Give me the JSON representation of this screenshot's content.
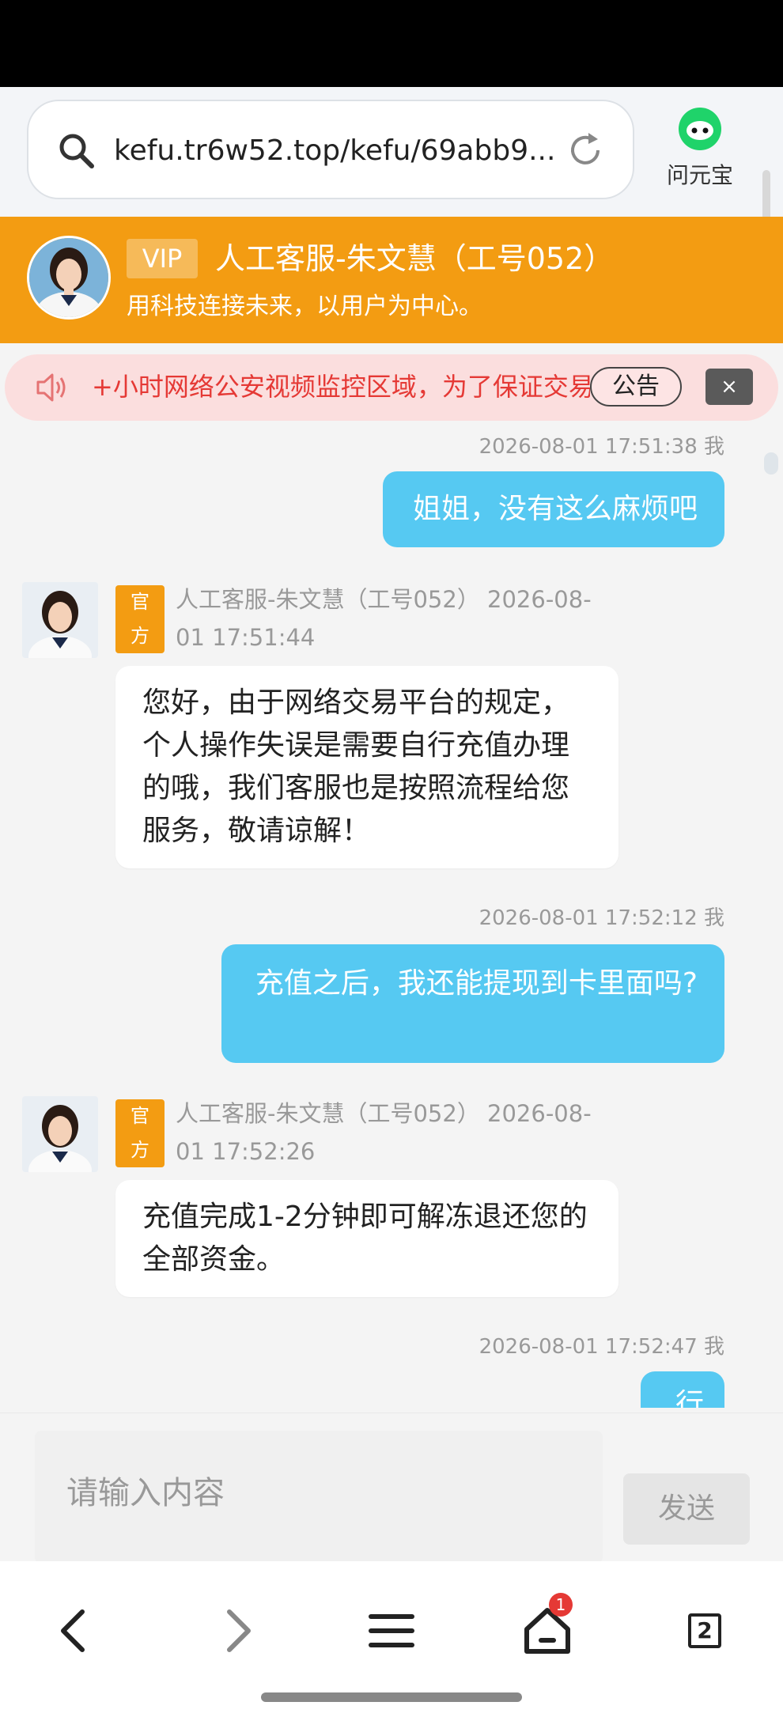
{
  "browser": {
    "url": "kefu.tr6w52.top/kefu/69abb9...",
    "assistant_label": "问元宝"
  },
  "header": {
    "vip": "VIP",
    "agent_name": "人工客服-朱文慧（工号052）",
    "slogan": "用科技连接未来，以用户为中心。"
  },
  "notice": {
    "text": "+小时网络公安视频监控区域，为了保证交易安全",
    "button": "公告",
    "close": "×"
  },
  "official_tag": [
    "官",
    "方"
  ],
  "messages": {
    "m1": {
      "meta": "2026-08-01 17:51:38 我",
      "text": "姐姐，没有这么麻烦吧"
    },
    "m2": {
      "meta": "人工客服-朱文慧（工号052） 2026-08-01 17:51:44",
      "text": "您好，由于网络交易平台的规定，个人操作失误是需要自行充值办理的哦，我们客服也是按照流程给您服务，敬请谅解！"
    },
    "m3": {
      "meta": "2026-08-01 17:52:12 我",
      "text": "充值之后，我还能提现到卡里面吗?"
    },
    "m4": {
      "meta": "人工客服-朱文慧（工号052） 2026-08-01 17:52:26",
      "text": "充值完成1-2分钟即可解冻退还您的全部资金。"
    },
    "m5": {
      "meta": "2026-08-01 17:52:47 我",
      "text": "行"
    }
  },
  "composer": {
    "placeholder": "请输入内容",
    "send": "发送"
  },
  "nav": {
    "notif_count": "1",
    "tab_count": "2"
  },
  "colors": {
    "accent_orange": "#f39c12",
    "self_bubble": "#56c9f2",
    "notice_text": "#e53935"
  }
}
